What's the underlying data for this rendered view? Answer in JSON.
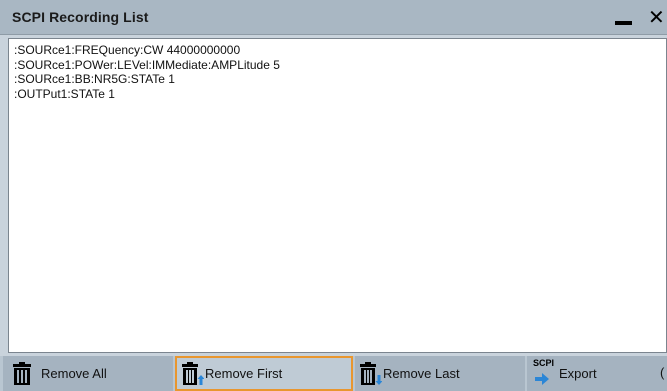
{
  "window": {
    "title": "SCPI Recording List",
    "minimize_icon": "minimize-icon",
    "close_symbol": "✕"
  },
  "recording": {
    "lines": [
      ":SOURce1:FREQuency:CW 44000000000",
      ":SOURce1:POWer:LEVel:IMMediate:AMPLitude 5",
      ":SOURce1:BB:NR5G:STATe 1",
      ":OUTPut1:STATe 1"
    ]
  },
  "toolbar": {
    "remove_all_label": "Remove All",
    "remove_first_label": "Remove First",
    "remove_last_label": "Remove Last",
    "export_badge": "SCPI",
    "export_label": "Export",
    "overflow_glyph": "("
  },
  "colors": {
    "accent_active_border": "#e8962f",
    "icon_blue": "#2b86d6"
  }
}
